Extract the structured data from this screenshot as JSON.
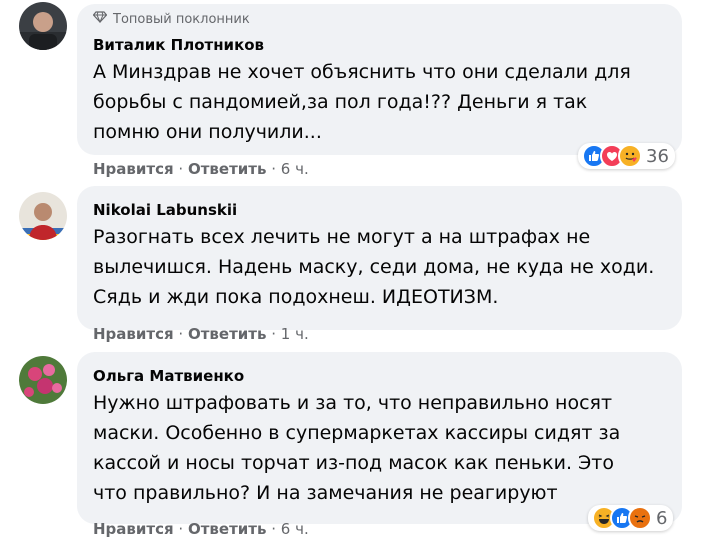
{
  "comments": [
    {
      "badge": "Топовый поклонник",
      "author": "Виталик Плотников",
      "text_lines": [
        "А Минздрав не хочет объяснить что они сделали для",
        "борьбы с пандомией,за пол года!?? Деньги я так",
        "помню они получили..."
      ],
      "like": "Нравится",
      "reply": "Ответить",
      "time": "6 ч.",
      "reactions": [
        "like",
        "love",
        "care"
      ],
      "reaction_count": "36"
    },
    {
      "author": "Nikolai Labunskii",
      "text_lines": [
        "Разогнать всех лечить не могут а на штрафах не",
        "вылечишся. Надень маску, седи дома, не куда не ходи.",
        "Сядь и жди пока подохнеш. ИДЕОТИЗМ."
      ],
      "like": "Нравится",
      "reply": "Ответить",
      "time": "1 ч."
    },
    {
      "author": "Ольга Матвиенко",
      "text_lines": [
        "Нужно штрафовать и за то, что неправильно носят",
        "маски. Особенно в супермаркетах кассиры сидят за",
        "кассой и носы торчат из-под масок как пеньки. Это",
        "что правильно? И на замечания не реагируют"
      ],
      "like": "Нравится",
      "reply": "Ответить",
      "time": "6 ч.",
      "reactions": [
        "haha",
        "like",
        "angry"
      ],
      "reaction_count": "6"
    }
  ],
  "separator": " · ",
  "colors": {
    "like": "#1877f2",
    "love": "#f33e58",
    "care": "#f7b125",
    "haha": "#f7b125",
    "angry": "#e9710f",
    "bubble": "#f0f2f5",
    "meta": "#65676b"
  }
}
